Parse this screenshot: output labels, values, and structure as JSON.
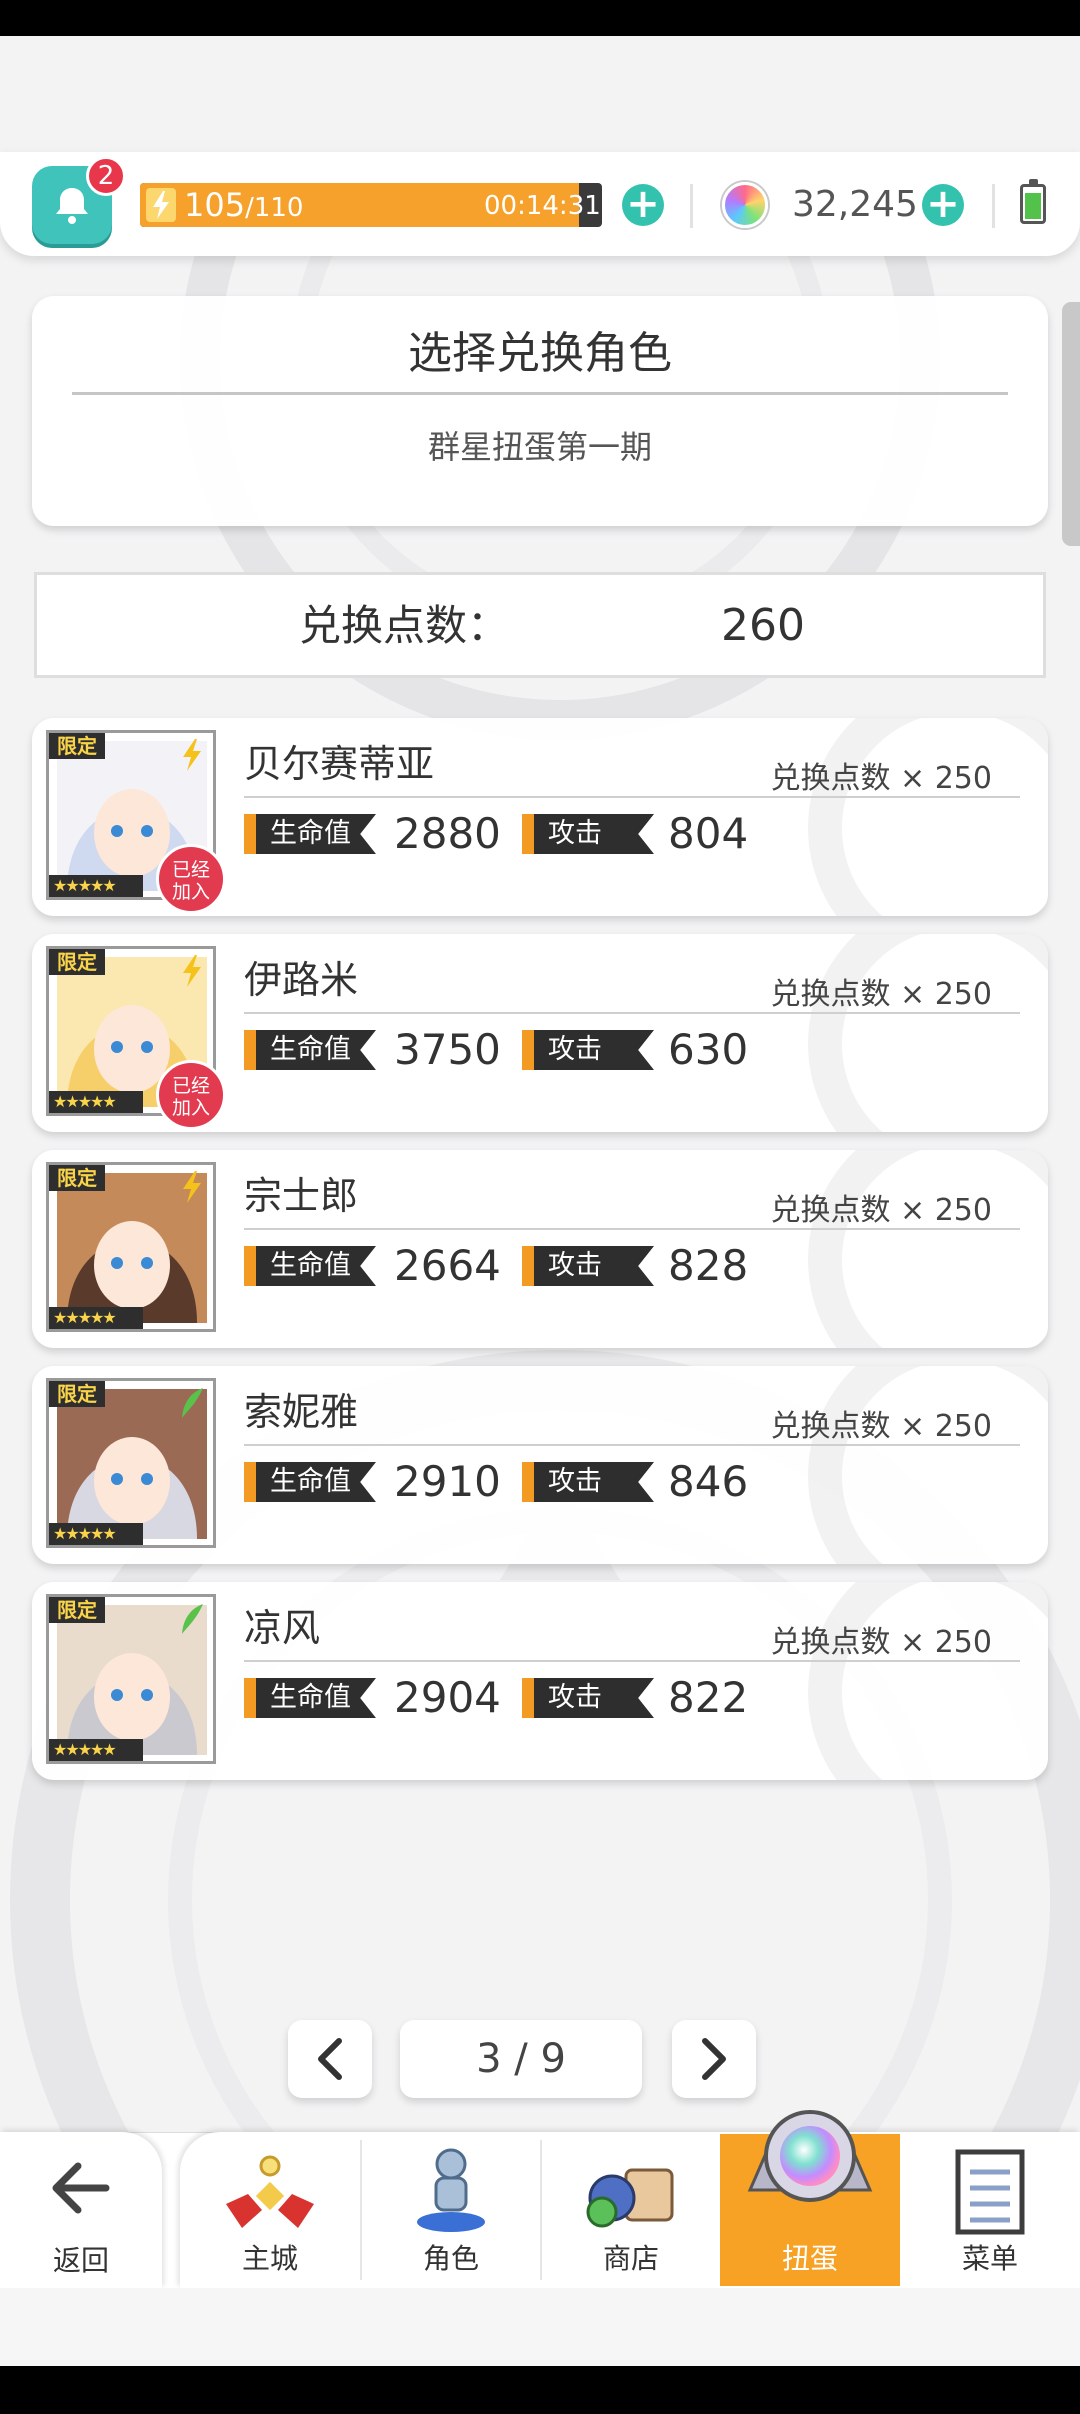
{
  "header": {
    "notification_count": "2",
    "energy": {
      "current": "105",
      "max": "/110",
      "timer": "00:14:31",
      "fill_fraction": 0.95
    },
    "gems": "32,245"
  },
  "panel": {
    "title": "选择兑换角色",
    "subtitle": "群星扭蛋第一期"
  },
  "points": {
    "label": "兑换点数：",
    "value": "260"
  },
  "characters": [
    {
      "name": "贝尔赛蒂亚",
      "cost": "兑换点数 × 250",
      "hp_label": "生命值",
      "hp": "2880",
      "atk_label": "攻击",
      "atk": "804",
      "limited": "限定",
      "stars": "★★★★★",
      "joined": "已经加入",
      "element": "thunder"
    },
    {
      "name": "伊路米",
      "cost": "兑换点数 × 250",
      "hp_label": "生命值",
      "hp": "3750",
      "atk_label": "攻击",
      "atk": "630",
      "limited": "限定",
      "stars": "★★★★★",
      "joined": "已经加入",
      "element": "thunder"
    },
    {
      "name": "宗士郎",
      "cost": "兑换点数 × 250",
      "hp_label": "生命值",
      "hp": "2664",
      "atk_label": "攻击",
      "atk": "828",
      "limited": "限定",
      "stars": "★★★★★",
      "joined": "",
      "element": "thunder"
    },
    {
      "name": "索妮雅",
      "cost": "兑换点数 × 250",
      "hp_label": "生命值",
      "hp": "2910",
      "atk_label": "攻击",
      "atk": "846",
      "limited": "限定",
      "stars": "★★★★★",
      "joined": "",
      "element": "wind"
    },
    {
      "name": "凉风",
      "cost": "兑换点数 × 250",
      "hp_label": "生命值",
      "hp": "2904",
      "atk_label": "攻击",
      "atk": "822",
      "limited": "限定",
      "stars": "★★★★★",
      "joined": "",
      "element": "wind"
    }
  ],
  "pagination": {
    "indicator": "3 / 9"
  },
  "nav": {
    "back": "返回",
    "items": [
      "主城",
      "角色",
      "商店",
      "扭蛋",
      "菜单"
    ],
    "active_index": 3
  },
  "colors": {
    "accent": "#f7a125",
    "teal": "#3fc3bb",
    "badge_red": "#e23a4f",
    "stat_dark": "#2e2e2e"
  },
  "icons": {
    "bell": "bell-icon",
    "energy": "lightning-icon",
    "gem": "rainbow-gem-icon",
    "battery": "battery-icon",
    "thunder": "thunder-element-icon",
    "wind": "wind-element-icon",
    "back": "arrow-left-icon",
    "prev": "chevron-left-icon",
    "next": "chevron-right-icon"
  }
}
